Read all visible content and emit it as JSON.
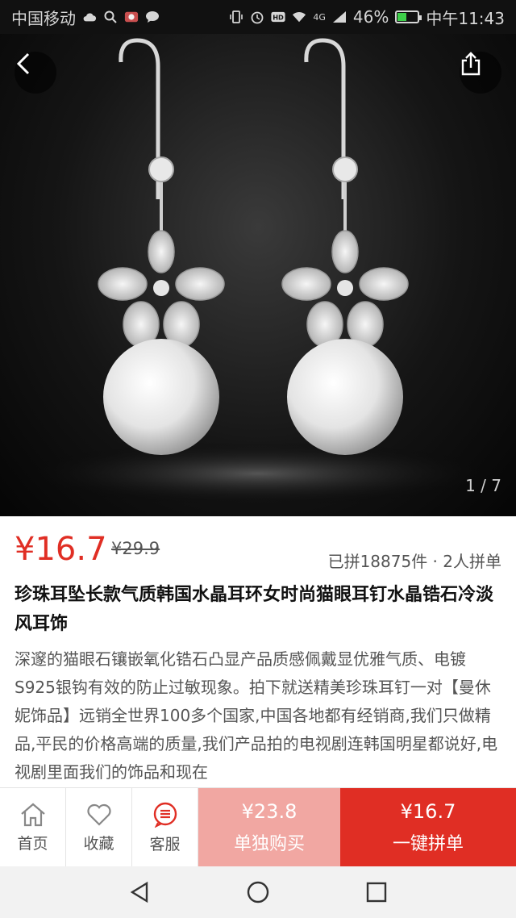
{
  "status_bar": {
    "carrier": "中国移动",
    "network": "4G",
    "battery_percent": "46%",
    "battery_level": 0.46,
    "time": "中午11:43"
  },
  "gallery": {
    "counter": "1 / 7",
    "back_icon": "chevron-left-icon",
    "share_icon": "share-icon"
  },
  "product": {
    "price": "¥16.7",
    "original_price": "¥29.9",
    "sales_info": "已拼18875件 · 2人拼单",
    "title": "珍珠耳坠长款气质韩国水晶耳环女时尚猫眼耳钉水晶锆石冷淡风耳饰",
    "description": "深邃的猫眼石镶嵌氧化锆石凸显产品质感佩戴显优雅气质、电镀S925银钩有效的防止过敏现象。拍下就送精美珍珠耳钉一对【曼休妮饰品】远销全世界100多个国家,中国各地都有经销商,我们只做精品,平民的价格高端的质量,我们产品拍的电视剧连韩国明星都说好,电视剧里面我们的饰品和现在"
  },
  "action_bar": {
    "home_label": "首页",
    "favorite_label": "收藏",
    "service_label": "客服",
    "solo_price": "¥23.8",
    "solo_label": "单独购买",
    "group_price": "¥16.7",
    "group_label": "一键拼单"
  },
  "colors": {
    "accent_red": "#e02e24",
    "solo_pink": "#f1a7a2"
  }
}
